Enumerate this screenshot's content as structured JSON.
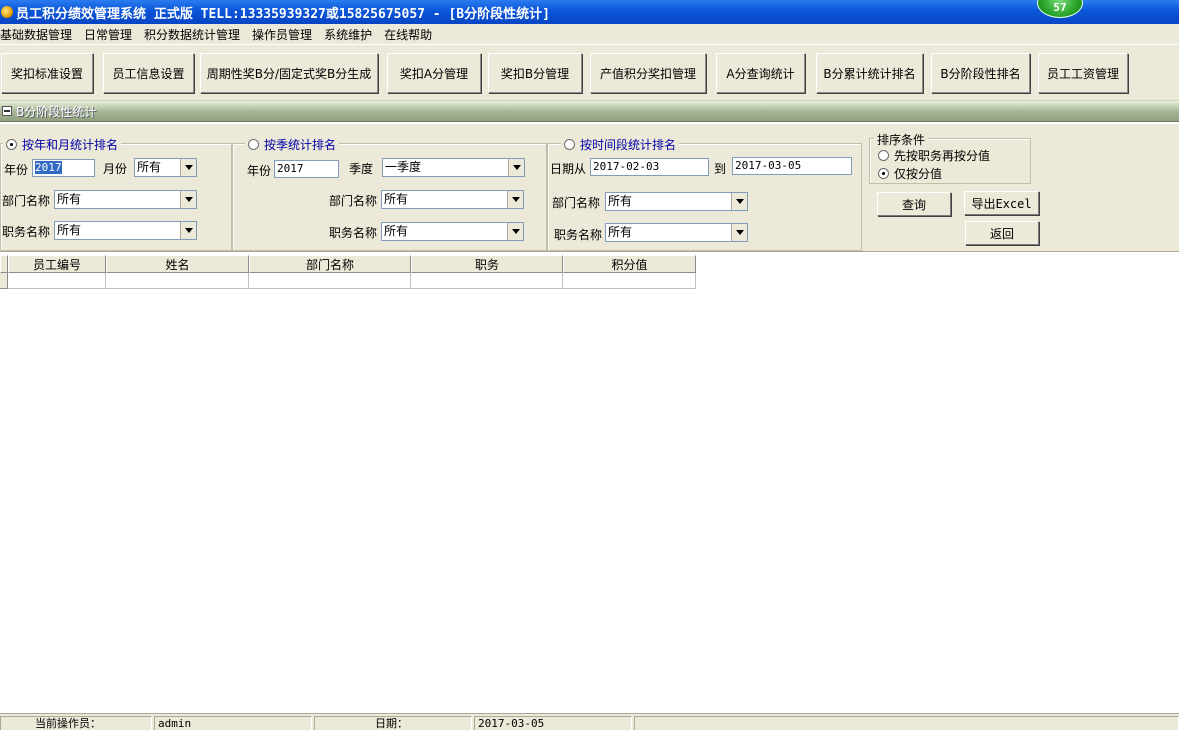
{
  "window": {
    "title": "员工积分绩效管理系统 正式版 TELL:13335939327或15825675057 - [B分阶段性统计]",
    "badge_count": "57"
  },
  "menu": {
    "items": [
      "基础数据管理",
      "日常管理",
      "积分数据统计管理",
      "操作员管理",
      "系统维护",
      "在线帮助"
    ]
  },
  "toolbar": {
    "buttons": [
      "奖扣标准设置",
      "员工信息设置",
      "周期性奖B分/固定式奖B分生成",
      "奖扣A分管理",
      "奖扣B分管理",
      "产值积分奖扣管理",
      "A分查询统计",
      "B分累计统计排名",
      "B分阶段性排名",
      "员工工资管理"
    ]
  },
  "section": {
    "title": "B分阶段性统计"
  },
  "filters": {
    "by_month": {
      "legend": "按年和月统计排名",
      "year_label": "年份",
      "year_value": "2017",
      "month_label": "月份",
      "month_value": "所有",
      "dept_label": "部门名称",
      "dept_value": "所有",
      "post_label": "职务名称",
      "post_value": "所有"
    },
    "by_quarter": {
      "legend": "按季统计排名",
      "year_label": "年份",
      "year_value": "2017",
      "quarter_label": "季度",
      "quarter_value": "一季度",
      "dept_label": "部门名称",
      "dept_value": "所有",
      "post_label": "职务名称",
      "post_value": "所有"
    },
    "by_period": {
      "legend": "按时间段统计排名",
      "from_label": "日期从",
      "from_value": "2017-02-03",
      "to_label": "到",
      "to_value": "2017-03-05",
      "dept_label": "部门名称",
      "dept_value": "所有",
      "post_label": "职务名称",
      "post_value": "所有"
    },
    "sort": {
      "legend": "排序条件",
      "option1": "先按职务再按分值",
      "option2": "仅按分值"
    }
  },
  "actions": {
    "query": "查询",
    "export": "导出Excel",
    "back": "返回"
  },
  "grid": {
    "columns": [
      "员工编号",
      "姓名",
      "部门名称",
      "职务",
      "积分值"
    ]
  },
  "status": {
    "operator_label": "当前操作员：",
    "operator_value": "admin",
    "date_label": "日期：",
    "date_value": "2017-03-05"
  }
}
